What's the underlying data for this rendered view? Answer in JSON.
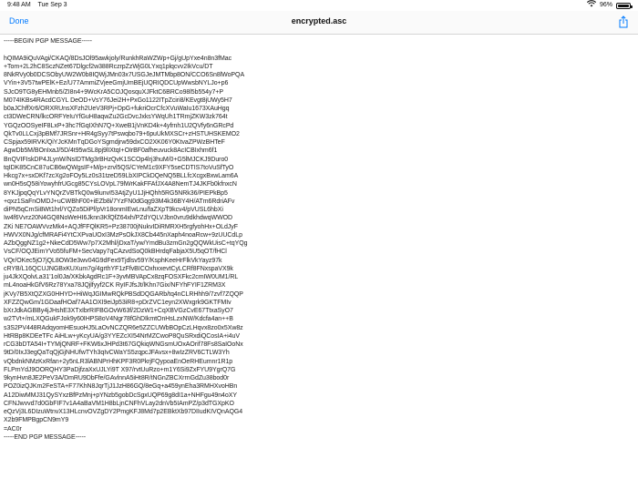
{
  "status_bar": {
    "time": "9:48 AM",
    "date": "Tue Sep 3",
    "wifi_icon": "wifi-icon",
    "battery_percent": "96%",
    "battery_level": 0.96
  },
  "nav": {
    "done_label": "Done",
    "title": "encrypted.asc",
    "share_icon": "share-icon",
    "accent_color": "#007aff"
  },
  "document": {
    "text": "-----BEGIN PGP MESSAGE-----\n\nhQIMA9iQuVAgi/CKAQ/8DsJOl95awkjoly/RunkhRaWZWp+Gj/gUpYxe4n8n3fMac\n+Tom+2L2hC8SczNZet67Dlgcf2w388RczrpZzWjG0LYxq1plqcvv2IkVcu/DT\n8NkRVy0b0DCSObyUW2W0b8IQWjJMn03x7USGJeJMTMbp8ON/CCO6Sn8lWoPQA\nVYin+3V57twPElK+Ez/U77AmmiZVjeeGmjUmBEjUQRIQDCUpWwsbNYLJo+p6\nSJcO9TG8yEHMnb5/ZI8n4+9WcKrA5COJQosquXJFktC6BRCo98l5b554y7+P\nM074IKBs4RAcdCGYL DeOD+VsY76Jei2H+PxGo1122ITpZciri8/KEvgt8jUWy5H7\nb0aJChffXr6/ORXRUnsXFzh2UeV3RPj+DpG+fukriOcrCfcXVuWaIu1673XAuHgq\nct3DWeCRN/lkcORFYeIuYfGuH8aqwZu2GcDvcJxksYWqUh1TRmjZKW3zk764t\nYGQzOOSyeIF8LxP+3hc7fGqIXhN7Q+XweB1jVnKD4k+4yfrnh1U2QVfy6nGRcPd\nQkTv0LLCxj3pBMf7JRSnr+HR4gSyy7tPswqbo79+6puUkMXSCr+zHSTUHSKEMO2\nCSpjax59IRVK/QiYJcKMnTqDGoYSgmdjrw59dxCO2XK06Y0KtvaZPWzBHTeF\nAgwDb5M/BOnIxaJ/5D/4t95wSL8pj9lIXtqI+OIrBF0afheuvuck8AcICBIxhm6f1\nBnQVIFIskDP4JLynW/NsIDTMg3rBHzQvK1SCOp4lrj3huM/0+G5lMJCKJ9Duro0\ntqIDK85CnC87uCB6wQWgsIF+M/p+zrvl5QS/CYeM1c9XFY5seCDTIS7toVuSfTyO\nHkcg7x+sxDKf7zcXg2oFOy5Lz0s31tzeD59LbXIPCkDQeNQ5BLLfcXcgxBxwLam6A\nwn0H5sQ58iYowyhfrUGcg85CYsLOVpL79lWrKakFFAfJX4A8NemTJ4JKFb0kfnxcN\n8YKJjpqQqYLvYNQrZVBTkQ0w9lunvI53AtjZyU1JjHQhh5RG5NRk36/PIEPkBp5\n+qxz1SaFnOMDJ+uCWBhF00+iEZb8i/7YzFN0dGqg93M4k36BY4H/ATm6RdriAFv\ndiPN5qCmSi8Wt1hrl/YQZo5DiPf/pVr18onmIEwLnu/faZXpT9kcv4/pVUSL6hbXi\nIw4f6Vvrz20N4GQ8NoWeHI6Jknn3KfQfZ64xh/PZdYQLVJbn0vru9dkhdwqWWOD\nZKi NE7OAWVvzMk4+AQJfFFQlKR5+Pz38700jNukvIDiRMRXH5rgfyohHx+OLdJyF\nHWVX0NJg/cfMRAFi4YtCXPvaUOxI3MzPsOkJX8Cb445nXaph4noaRcw+9zUUCdLp\nAZbQggNZ1g2+NkeCdD5Ww7p7X2Mhl/jDxaT/yw/YmdBu3zmGn2gQQWkUisC+tqYQg\nVsCF/OQJEimYVo55fuFM+SecVapy7qCAzvdSoQ0kBHrdqFabjaX5U5qOT/fHCl\nVQr/OKec5jO7jQL8OW3e3wv04G9dFex9Tjdlsv59Y/KsphKeeHrFlkVkYayz97k\ncRYB/L16QCUJNGBxKUXum7g/4grthYF1zFfvBICOxhxxevtCyLCRf8FNxspaVX9k\nju4JkXQolvLa31'1ol0Ja/XKbkAgdRc1F+3yvMBVApCx8zqFOSXFkc2cmIW0UM1/RL\nmL4noaHkGfV6Rz78Yxa78JQjlfyyf2CK RyIFJfsJt/lKhn7Gix/NFYhFYIF1ZRM3X\njKVy7B5XtQZXG0HHYD+HiWqJGIMwRQkPBSdDQGARb/tq4nCLRHhh9/7zvf7ZQQP\nXFZZQwGm/1GDaafHOaf7AA1OXI9eiJp53iR8+pDrZVC1eyn2XWxgrk9GKTFMIv\nbXrJdkAGBBy4jJHshE3XTxIbrRIFBGOvW63f/2DzW1+CqXBVGzCvE67TtxaSyO7\nw2TVt+/mLXQGukFJok9y60IHPS8oV4Ngr78fGhDIkmtOnHsLzxNW/Kdcfa4an++B\ns3S2PV448RAdqyomHEsuoHJ5LaOvNCZQR6e5ZZCUWbBOpCzLHqvx8zo0x5Xw8z\nHtRBp8KDEeTFc AiHLw+yKcyUA/g3YYEZcXI54NrMZCwoP8QuSRxdiQCosIA+i4uV\nrCG3bDTA54I+TYMjQNRF+FKW6xJHPd3t67GQkiqWNGsmUOxAOrif78Fs8SaIOoNx\n9tD/0IxJ3egQaTqQjGjNHUfwTYh3qIvCWaYS5zqpcJFAvsx+8wIzZRV6CTLW3Yh\nvQbdnkNMzKxRfan+2y5nLR3lABNPrHhKPF3R0PkrjFQypoaEnOeRHEumnr1R1p\nFLPmYdJ9OORQHY3PaDjfzaXxUJLYi9T X97/rvtUuRzo+m1Y6Si9ZxFYU9YgrQ7G\n9kynHvn8JE2PeV3A/DmRU9DbFfe/GAvlnnA5iHt8R/tNGnZBCXrrnGdZu38bod0r\nPOZ0izQJKm2FeSTA+F77KhN8JqrTjJ1JzH86GQ/8eGq+a459ynEha3RMHXvoHBn\nA12DiwMMJ31QySYxzBfPzMnj+pYNzb5gobDcSgxUQP69g8dI1a+NHFgu49n4oXY\nCFNJwvvd7d0GbFIF7v1A4aBaVM1H8bLjnCNFhVLay2dnVb5IAmPZ/p3dTGXpKO\neQzVj3L6DIzuWtnvX13HLcnvOVZgDY2PmgKFJ8Md7p2EBktXb97DIIudKIVQnAQG4\nX2b9FMPBgpCN9mY9\n=AC0r\n-----END PGP MESSAGE-----"
  }
}
